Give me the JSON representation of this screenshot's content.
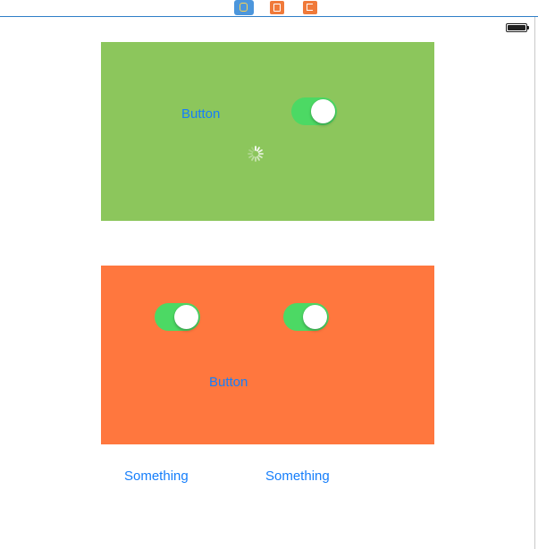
{
  "scene_dock": {
    "icons": [
      "view-controller-icon",
      "first-responder-icon",
      "exit-icon"
    ]
  },
  "status_bar": {
    "battery": "full"
  },
  "green_panel": {
    "color": "#8cc65c",
    "button_label": "Button",
    "switch_on": true
  },
  "orange_panel": {
    "color": "#ff773e",
    "switch_left_on": true,
    "switch_right_on": true,
    "button_label": "Button"
  },
  "bottom_buttons": [
    {
      "label": "Something"
    },
    {
      "label": "Something"
    }
  ],
  "colors": {
    "tint": "#157efb",
    "switch_on": "#4cd964"
  }
}
